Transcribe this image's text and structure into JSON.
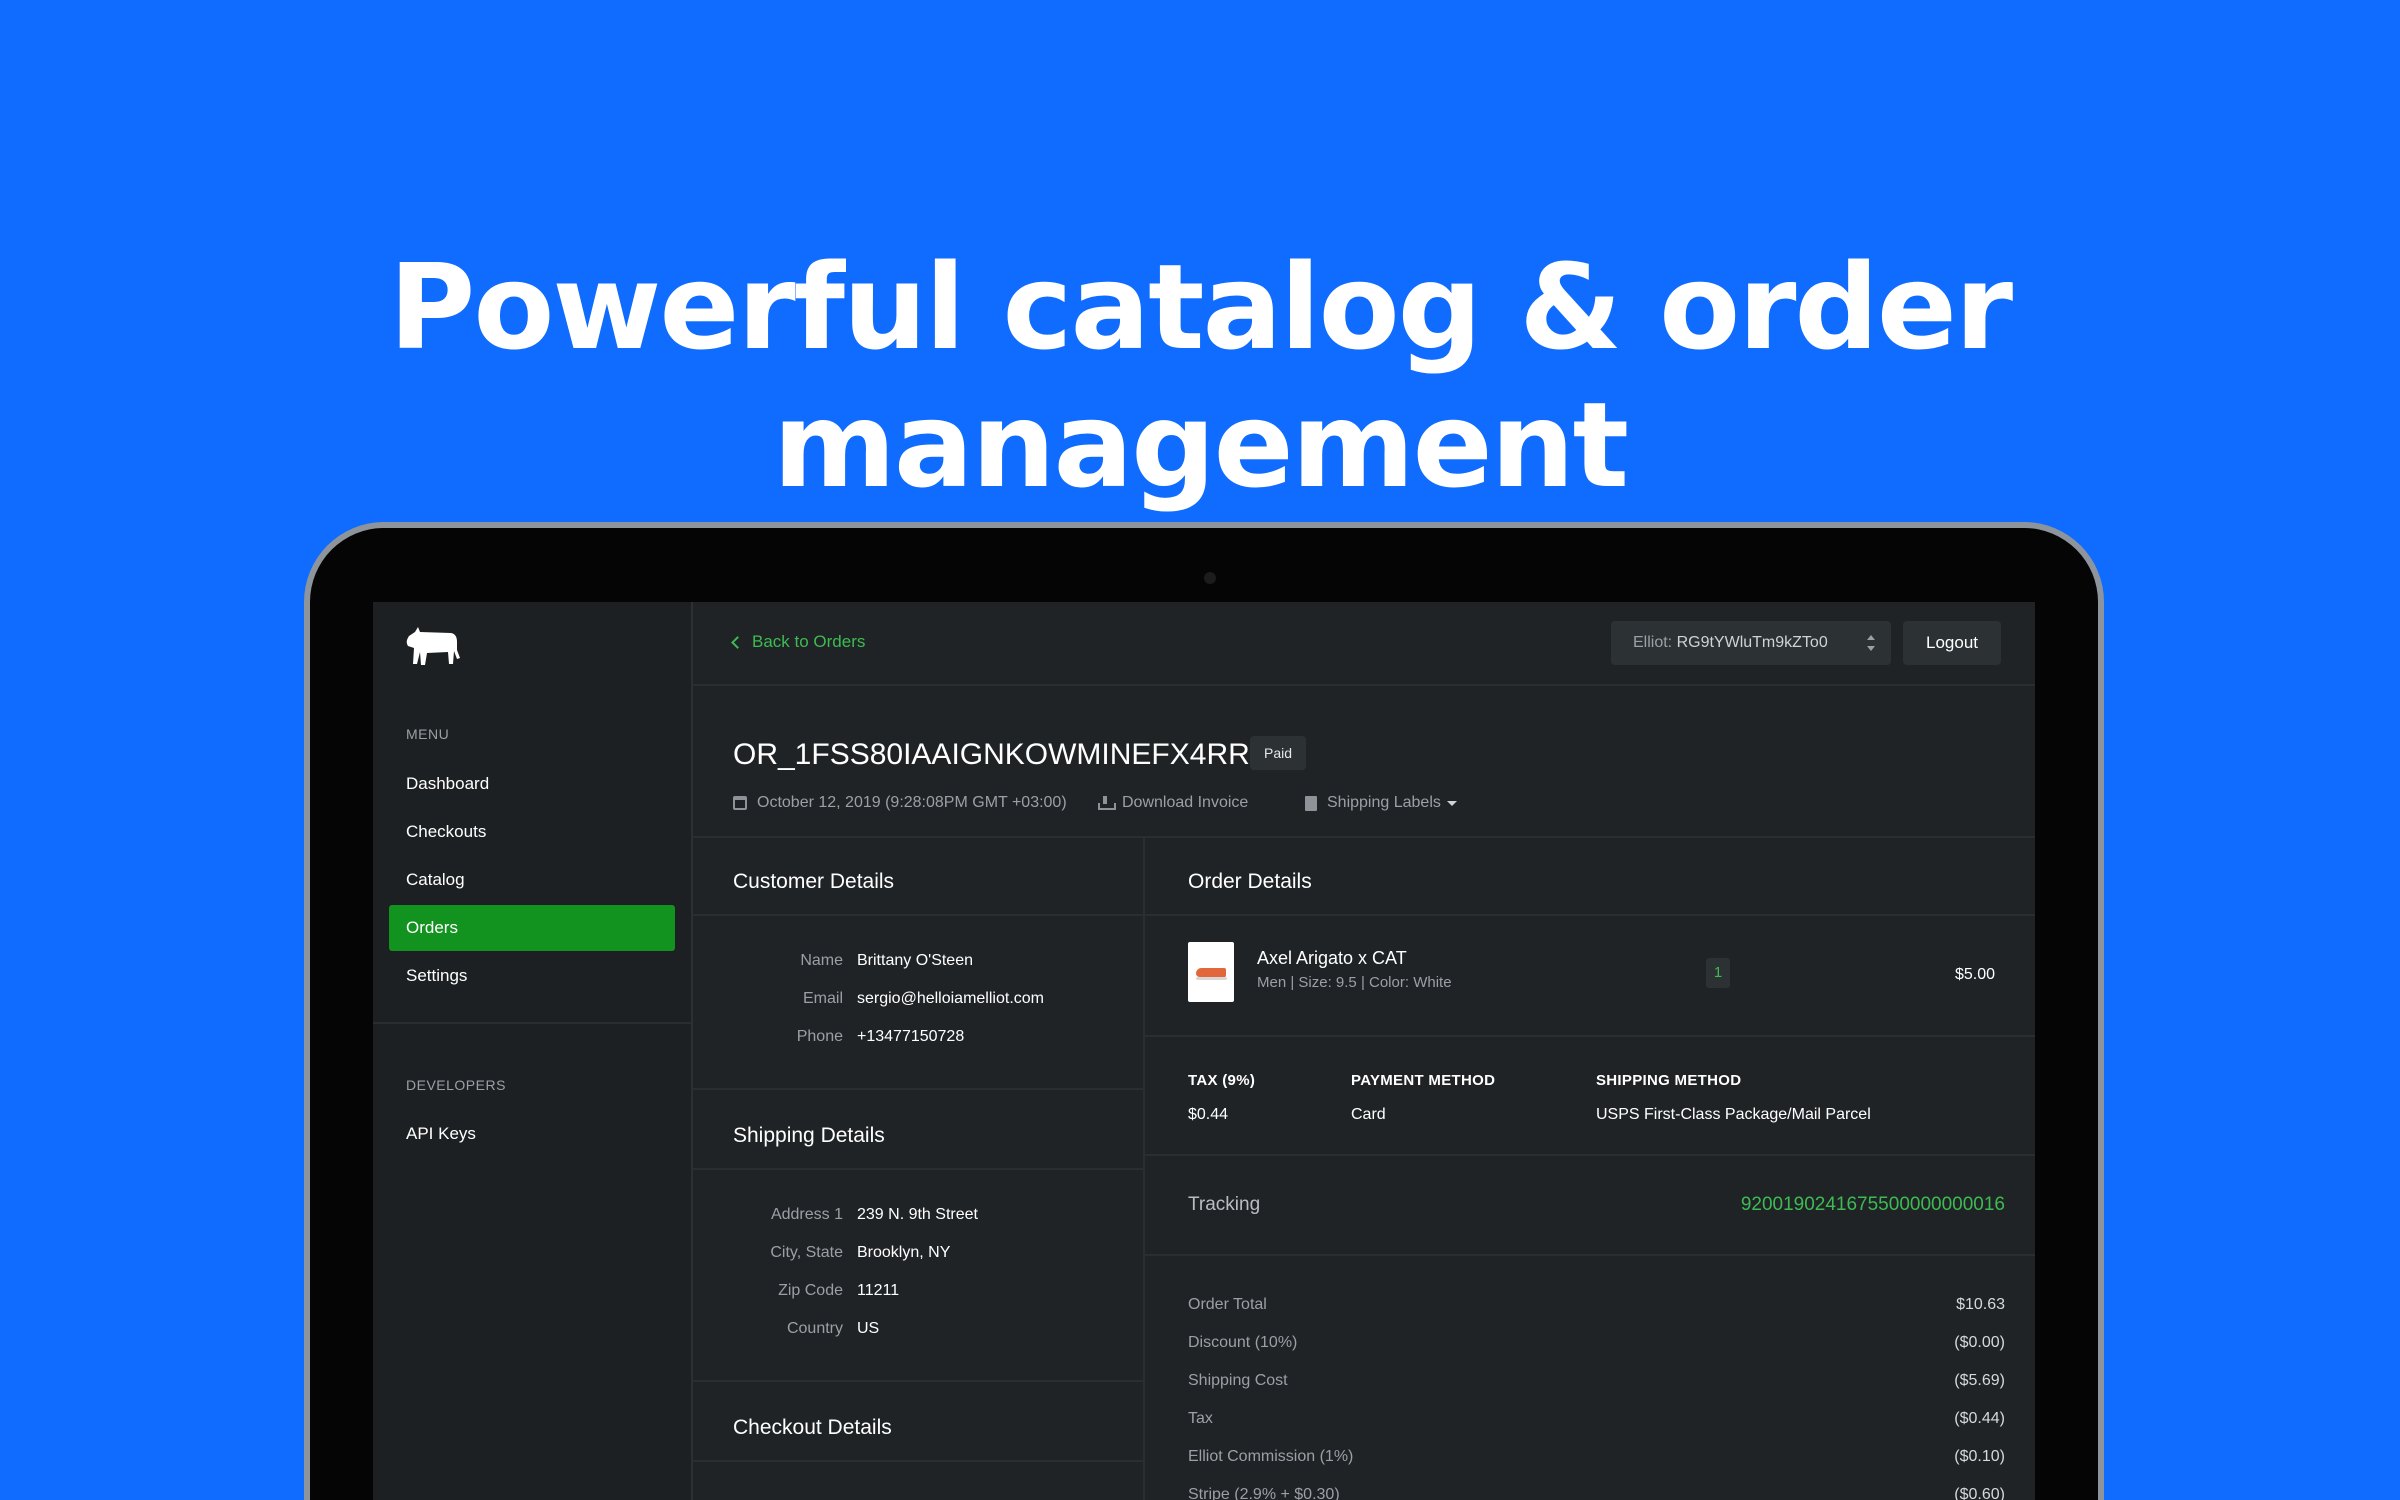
{
  "headline": "Powerful catalog & order management",
  "sidebar": {
    "menu_label": "MENU",
    "items": [
      {
        "label": "Dashboard"
      },
      {
        "label": "Checkouts"
      },
      {
        "label": "Catalog"
      },
      {
        "label": "Orders",
        "active": true
      },
      {
        "label": "Settings"
      }
    ],
    "developers_label": "DEVELOPERS",
    "dev_items": [
      {
        "label": "API Keys"
      }
    ]
  },
  "topbar": {
    "back_label": "Back to Orders",
    "account_prefix": "Elliot:",
    "account_value": "RG9tYWluTm9kZTo0",
    "logout_label": "Logout"
  },
  "order": {
    "id": "OR_1FSS80IAAIGNKOWMINEFX4RR",
    "status": "Paid",
    "date": "October 12, 2019 (9:28:08PM GMT +03:00)",
    "download_invoice": "Download Invoice",
    "shipping_labels": "Shipping Labels"
  },
  "customer": {
    "title": "Customer Details",
    "rows": [
      {
        "key": "Name",
        "value": "Brittany O'Steen"
      },
      {
        "key": "Email",
        "value": "sergio@helloiamelliot.com"
      },
      {
        "key": "Phone",
        "value": "+13477150728"
      }
    ]
  },
  "shipping": {
    "title": "Shipping Details",
    "rows": [
      {
        "key": "Address 1",
        "value": "239 N. 9th Street"
      },
      {
        "key": "City, State",
        "value": "Brooklyn, NY"
      },
      {
        "key": "Zip Code",
        "value": "11211"
      },
      {
        "key": "Country",
        "value": "US"
      }
    ]
  },
  "checkout": {
    "title": "Checkout Details"
  },
  "order_details": {
    "title": "Order Details",
    "product": {
      "name": "Axel Arigato x CAT",
      "sub": "Men | Size: 9.5 | Color: White",
      "qty": "1",
      "price": "$5.00"
    },
    "tax_label": "TAX (9%)",
    "tax_value": "$0.44",
    "payment_label": "PAYMENT METHOD",
    "payment_value": "Card",
    "shipping_method_label": "SHIPPING METHOD",
    "shipping_method_value": "USPS First-Class Package/Mail Parcel",
    "tracking_label": "Tracking",
    "tracking_value": "9200190241675500000000016",
    "totals": [
      {
        "label": "Order Total",
        "value": "$10.63"
      },
      {
        "label": "Discount (10%)",
        "value": "($0.00)"
      },
      {
        "label": "Shipping Cost",
        "value": "($5.69)"
      },
      {
        "label": "Tax",
        "value": "($0.44)"
      },
      {
        "label": "Elliot Commission (1%)",
        "value": "($0.10)"
      },
      {
        "label": "Stripe (2.9% + $0.30)",
        "value": "($0.60)"
      }
    ]
  },
  "colors": {
    "background": "#0f6cfe",
    "accent_green": "#3dbb52",
    "active_nav": "#12921f",
    "app_bg": "#202326"
  },
  "icons": [
    "cow-logo-icon",
    "chevron-left-icon",
    "calendar-icon",
    "download-icon",
    "document-icon",
    "caret-down-icon",
    "updown-select-icon"
  ]
}
